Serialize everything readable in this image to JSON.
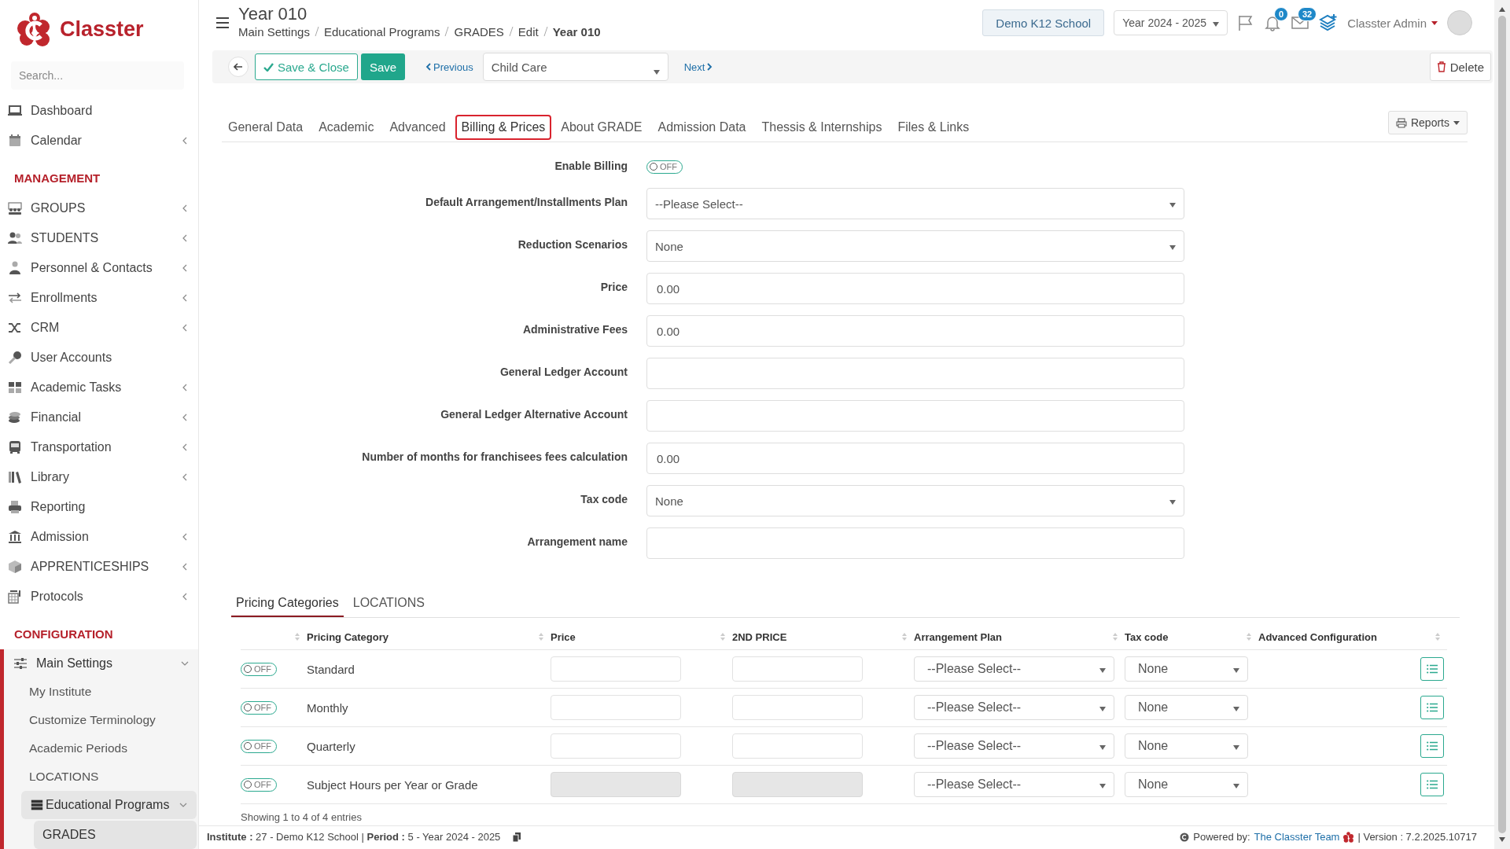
{
  "sidebar": {
    "logo": "Classter",
    "search": {
      "placeholder": "Search..."
    },
    "sections": [
      {
        "items": [
          {
            "label": "Dashboard",
            "kind": "link"
          },
          {
            "label": "Calendar",
            "kind": "menu",
            "expanded": false
          }
        ]
      },
      {
        "title": "MANAGEMENT",
        "items": [
          {
            "label": "GROUPS",
            "kind": "menu",
            "expanded": false
          },
          {
            "label": "STUDENTS",
            "kind": "menu",
            "expanded": false
          },
          {
            "label": "Personnel & Contacts",
            "kind": "menu",
            "expanded": false
          },
          {
            "label": "Enrollments",
            "kind": "menu",
            "expanded": false
          },
          {
            "label": "CRM",
            "kind": "menu",
            "expanded": false
          },
          {
            "label": "User Accounts",
            "kind": "link"
          },
          {
            "label": "Academic Tasks",
            "kind": "menu",
            "expanded": false
          },
          {
            "label": "Financial",
            "kind": "menu",
            "expanded": false
          },
          {
            "label": "Transportation",
            "kind": "menu",
            "expanded": false
          },
          {
            "label": "Library",
            "kind": "menu",
            "expanded": false
          },
          {
            "label": "Reporting",
            "kind": "link"
          },
          {
            "label": "Admission",
            "kind": "menu",
            "expanded": false
          },
          {
            "label": "APPRENTICESHIPS",
            "kind": "menu",
            "expanded": false
          },
          {
            "label": "Protocols",
            "kind": "menu",
            "expanded": false
          }
        ]
      },
      {
        "title": "CONFIGURATION",
        "items": [
          {
            "label": "Main Settings",
            "kind": "menu",
            "expanded": true,
            "children": [
              {
                "label": "My Institute",
                "kind": "link",
                "selected": false
              },
              {
                "label": "Customize Terminology",
                "kind": "link",
                "selected": false
              },
              {
                "label": "Academic Periods",
                "kind": "link",
                "selected": false
              },
              {
                "label": "LOCATIONS",
                "kind": "link",
                "selected": false
              },
              {
                "label": "Educational Programs",
                "kind": "menu",
                "expanded": true,
                "selected": true,
                "children": [
                  {
                    "label": "GRADES",
                    "kind": "link",
                    "selected": true
                  }
                ]
              }
            ]
          }
        ]
      }
    ]
  },
  "header": {
    "title": "Year 010",
    "breadcrumbs": [
      {
        "label": "Main Settings",
        "current": false
      },
      {
        "label": "Educational Programs",
        "current": false
      },
      {
        "label": "GRADES",
        "current": false
      },
      {
        "label": "Edit",
        "current": false
      },
      {
        "label": "Year 010",
        "current": true
      }
    ],
    "school": "Demo K12 School",
    "year": "Year 2024 - 2025",
    "notifications": "0",
    "messages": "32",
    "user": "Classter Admin"
  },
  "toolbar": {
    "save_close": "Save & Close",
    "save": "Save",
    "previous": "Previous",
    "record": "Child Care",
    "next": "Next",
    "delete": "Delete"
  },
  "tabs": [
    {
      "label": "General Data",
      "selected": false
    },
    {
      "label": "Academic",
      "selected": false
    },
    {
      "label": "Advanced",
      "selected": false
    },
    {
      "label": "Billing & Prices",
      "selected": true
    },
    {
      "label": "About GRADE",
      "selected": false
    },
    {
      "label": "Admission Data",
      "selected": false
    },
    {
      "label": "Thessis & Internships",
      "selected": false
    },
    {
      "label": "Files & Links",
      "selected": false
    }
  ],
  "reports": "Reports",
  "form": [
    {
      "label": "Enable Billing",
      "kind": "toggle",
      "toggle": {
        "label": "OFF",
        "on": false
      }
    },
    {
      "label": "Default Arrangement/Installments Plan",
      "kind": "select",
      "value": "--Please Select--"
    },
    {
      "label": "Reduction Scenarios",
      "kind": "select",
      "value": "None"
    },
    {
      "label": "Price",
      "kind": "input",
      "value": "0.00"
    },
    {
      "label": "Administrative Fees",
      "kind": "input",
      "value": "0.00"
    },
    {
      "label": "General Ledger Account",
      "kind": "input"
    },
    {
      "label": "General Ledger Alternative Account",
      "kind": "input"
    },
    {
      "label": "Number of months for franchisees fees calculation",
      "kind": "input",
      "value": "0.00"
    },
    {
      "label": "Tax code",
      "kind": "select",
      "value": "None"
    },
    {
      "label": "Arrangement name",
      "kind": "input"
    }
  ],
  "pricing": {
    "tabs": [
      {
        "label": "Pricing Categories",
        "selected": true
      },
      {
        "label": "LOCATIONS",
        "selected": false
      }
    ],
    "columns": [
      "Pricing Category",
      "Price",
      "2ND PRICE",
      "Arrangement Plan",
      "Tax code",
      "Advanced Configuration"
    ],
    "rows": [
      {
        "toggle": {
          "label": "OFF",
          "on": false
        },
        "category": "Standard",
        "disabled": false,
        "arrangement": "--Please Select--",
        "tax": "None"
      },
      {
        "toggle": {
          "label": "OFF",
          "on": false
        },
        "category": "Monthly",
        "disabled": false,
        "arrangement": "--Please Select--",
        "tax": "None"
      },
      {
        "toggle": {
          "label": "OFF",
          "on": false
        },
        "category": "Quarterly",
        "disabled": false,
        "arrangement": "--Please Select--",
        "tax": "None"
      },
      {
        "toggle": {
          "label": "OFF",
          "on": false
        },
        "category": "Subject Hours per Year or Grade",
        "disabled": true,
        "arrangement": "--Please Select--",
        "tax": "None"
      }
    ],
    "info": "Showing 1 to 4 of 4 entries"
  },
  "footer": {
    "info": "**Institute :** 27 - Demo K12 School | **Period :** 5 - Year 2024 - 2025",
    "powered_by": "Powered by:",
    "team": "The Classter Team",
    "version": "| Version : 7.2.2025.10717"
  }
}
